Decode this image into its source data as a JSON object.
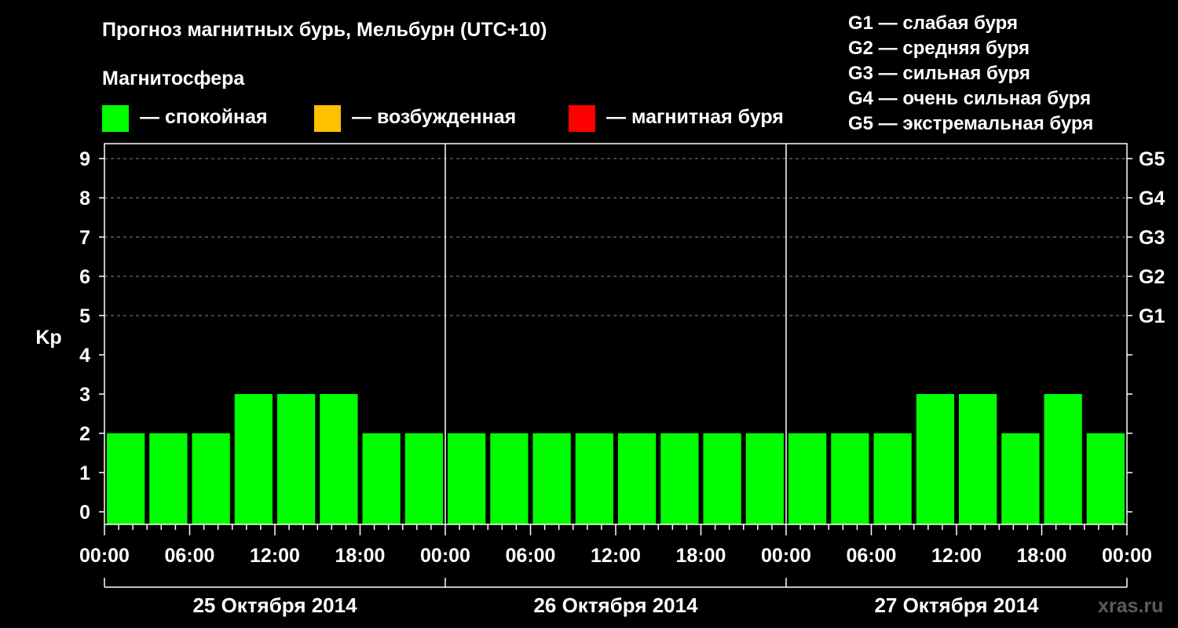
{
  "title": "Прогноз магнитных бурь, Мельбурн (UTC+10)",
  "magnetosphere_label": "Магнитосфера",
  "legend": [
    {
      "text": "— спокойная",
      "color": "#00ff00"
    },
    {
      "text": "— возбужденная",
      "color": "#ffc000"
    },
    {
      "text": "— магнитная буря",
      "color": "#ff0000"
    }
  ],
  "storm_scale": [
    "G1 — слабая буря",
    "G2 — средняя буря",
    "G3 — сильная буря",
    "G4 — очень сильная буря",
    "G5 — экстремальная буря"
  ],
  "watermark": "xras.ru",
  "chart_data": {
    "type": "bar",
    "ylabel": "Kp",
    "ylim": [
      0,
      9
    ],
    "y_ticks": [
      "0",
      "1",
      "2",
      "3",
      "4",
      "5",
      "6",
      "7",
      "8",
      "9"
    ],
    "right_axis_labels": [
      {
        "value": 5,
        "label": "G1"
      },
      {
        "value": 6,
        "label": "G2"
      },
      {
        "value": 7,
        "label": "G3"
      },
      {
        "value": 8,
        "label": "G4"
      },
      {
        "value": 9,
        "label": "G5"
      }
    ],
    "x_tick_labels": [
      "00:00",
      "06:00",
      "12:00",
      "18:00",
      "00:00",
      "06:00",
      "12:00",
      "18:00",
      "00:00",
      "06:00",
      "12:00",
      "18:00",
      "00:00"
    ],
    "days": [
      "25 Октября 2014",
      "26 Октября 2014",
      "27 Октября 2014"
    ],
    "bar_color": "#00ff00",
    "grid": "dashed horizontal at Kp 5–9",
    "series": [
      {
        "values": [
          2,
          2,
          2,
          3,
          3,
          3,
          2,
          2,
          2,
          2,
          2,
          2,
          2,
          2,
          2,
          2,
          2,
          2,
          2,
          3,
          3,
          2,
          3,
          2
        ]
      }
    ]
  }
}
